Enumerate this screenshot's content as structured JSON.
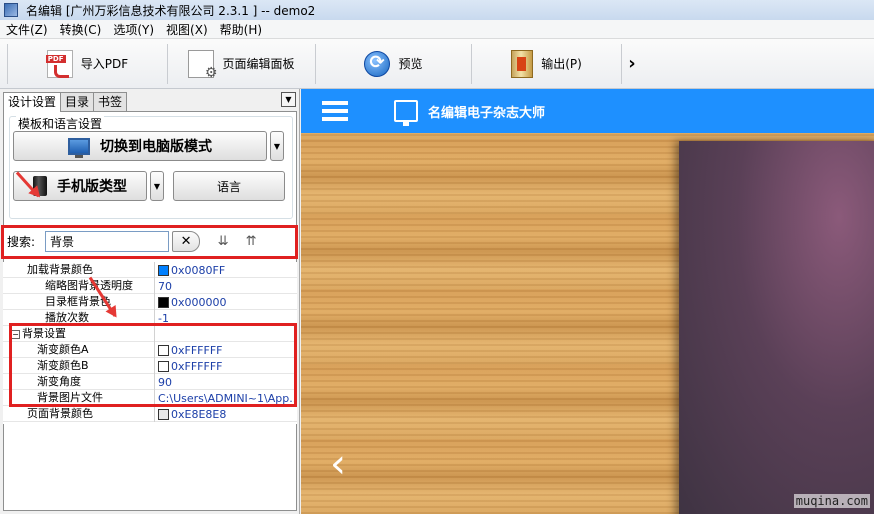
{
  "window": {
    "title": "名编辑 [广州万彩信息技术有限公司 2.3.1 ] -- demo2"
  },
  "menu": [
    "文件(Z)",
    "转换(C)",
    "选项(Y)",
    "视图(X)",
    "帮助(H)"
  ],
  "toolbar": {
    "import_pdf": "导入PDF",
    "page_editor": "页面编辑面板",
    "preview": "预览",
    "output": "输出(P)"
  },
  "left_panel": {
    "tabs": [
      "设计设置",
      "目录",
      "书签"
    ],
    "group_label": "模板和语言设置",
    "desktop_mode_btn": "切换到电脑版模式",
    "mobile_type_btn": "手机版类型",
    "language_btn": "语言",
    "search_label": "搜索:",
    "search_value": "背景"
  },
  "property_grid": {
    "rows": [
      {
        "name": "加载背景颜色",
        "value": "0x0080FF",
        "swatch": "#0080ff"
      },
      {
        "name": "缩略图背景透明度",
        "value": "70"
      },
      {
        "name": "目录框背景色",
        "value": "0x000000",
        "swatch": "#000000"
      },
      {
        "name": "播放次数",
        "value": "-1"
      },
      {
        "name": "背景设置",
        "value": "",
        "category": true,
        "toggle": "−"
      },
      {
        "name": "渐变颜色A",
        "value": "0xFFFFFF",
        "swatch": "#ffffff"
      },
      {
        "name": "渐变颜色B",
        "value": "0xFFFFFF",
        "swatch": "#ffffff"
      },
      {
        "name": "渐变角度",
        "value": "90"
      },
      {
        "name": "背景图片文件",
        "value": "C:\\Users\\ADMINI~1\\App..."
      },
      {
        "name": "页面背景颜色",
        "value": "0xE8E8E8",
        "swatch": "#e8e8e8"
      }
    ]
  },
  "preview": {
    "brand": "名编辑电子杂志大师",
    "header_color": "#1e90ff"
  },
  "watermark": "muqina.com",
  "colors": {
    "highlight_red": "#e02020"
  }
}
